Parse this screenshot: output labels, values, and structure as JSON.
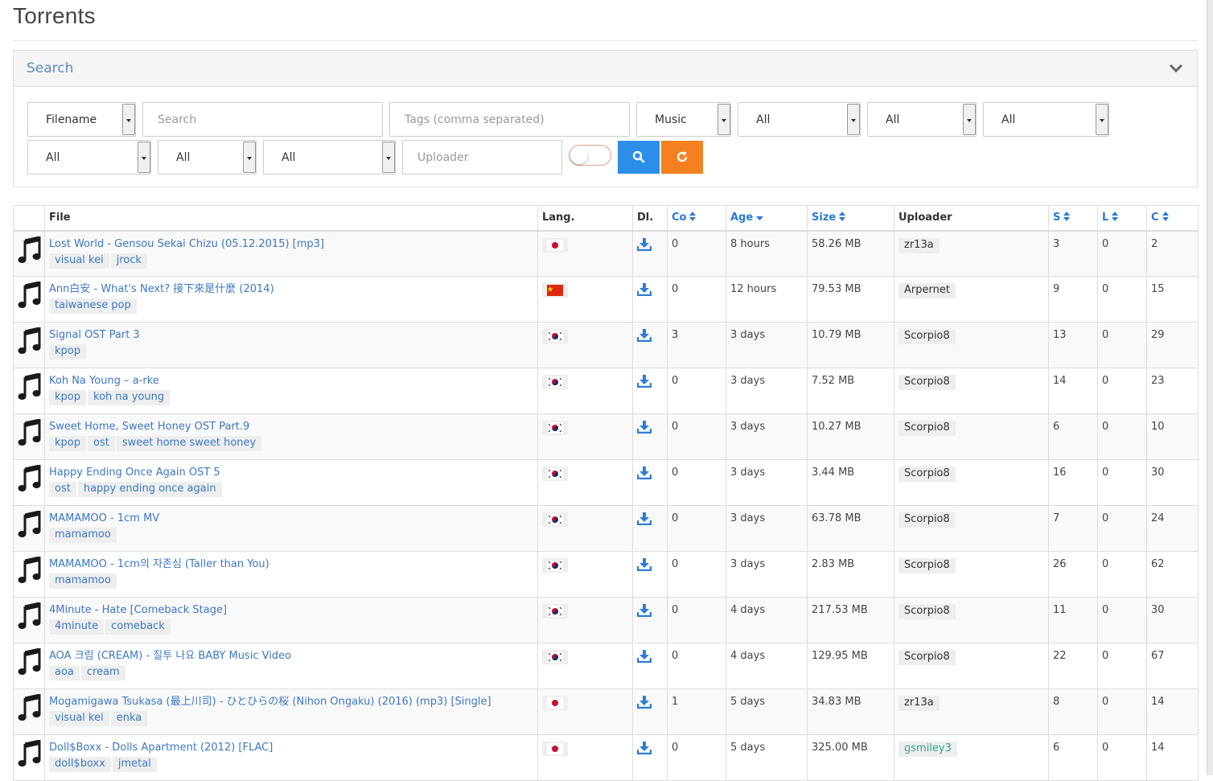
{
  "page": {
    "title": "Torrents"
  },
  "search": {
    "panel_title": "Search",
    "filename_select": "Filename",
    "search_placeholder": "Search",
    "tags_placeholder": "Tags (comma separated)",
    "category_select": "Music",
    "select_2": "All",
    "select_3": "All",
    "select_4": "All",
    "select_5": "All",
    "select_6": "All",
    "select_7": "All",
    "uploader_placeholder": "Uploader"
  },
  "table": {
    "headers": {
      "file": "File",
      "lang": "Lang.",
      "dl": "Dl.",
      "co": "Co",
      "age": "Age",
      "size": "Size",
      "uploader": "Uploader",
      "s": "S",
      "l": "L",
      "c": "C"
    },
    "rows": [
      {
        "name": "Lost World - Gensou Sekai Chizu (05.12.2015) [mp3]",
        "tags": [
          "visual kei",
          "jrock"
        ],
        "lang": "jp",
        "co": "0",
        "age": "8 hours",
        "size": "58.26 MB",
        "uploader": "zr13a",
        "s": "3",
        "l": "0",
        "c": "2"
      },
      {
        "name": "Ann白安 - What's Next? 接下來是什麼 (2014)",
        "tags": [
          "taiwanese pop"
        ],
        "lang": "cn",
        "co": "0",
        "age": "12 hours",
        "size": "79.53 MB",
        "uploader": "Arpernet",
        "s": "9",
        "l": "0",
        "c": "15"
      },
      {
        "name": "Signal OST Part 3",
        "tags": [
          "kpop"
        ],
        "lang": "kr",
        "co": "3",
        "age": "3 days",
        "size": "10.79 MB",
        "uploader": "Scorpio8",
        "s": "13",
        "l": "0",
        "c": "29"
      },
      {
        "name": "Koh Na Young – a-rke",
        "tags": [
          "kpop",
          "koh na young"
        ],
        "lang": "kr",
        "co": "0",
        "age": "3 days",
        "size": "7.52 MB",
        "uploader": "Scorpio8",
        "s": "14",
        "l": "0",
        "c": "23"
      },
      {
        "name": "Sweet Home, Sweet Honey OST Part.9",
        "tags": [
          "kpop",
          "ost",
          "sweet home sweet honey"
        ],
        "lang": "kr",
        "co": "0",
        "age": "3 days",
        "size": "10.27 MB",
        "uploader": "Scorpio8",
        "s": "6",
        "l": "0",
        "c": "10"
      },
      {
        "name": "Happy Ending Once Again OST 5",
        "tags": [
          "ost",
          "happy ending once again"
        ],
        "lang": "kr",
        "co": "0",
        "age": "3 days",
        "size": "3.44 MB",
        "uploader": "Scorpio8",
        "s": "16",
        "l": "0",
        "c": "30"
      },
      {
        "name": "MAMAMOO - 1cm MV",
        "tags": [
          "mamamoo"
        ],
        "lang": "kr",
        "co": "0",
        "age": "3 days",
        "size": "63.78 MB",
        "uploader": "Scorpio8",
        "s": "7",
        "l": "0",
        "c": "24"
      },
      {
        "name": "MAMAMOO - 1cm의 자존심 (Taller than You)",
        "tags": [
          "mamamoo"
        ],
        "lang": "kr",
        "co": "0",
        "age": "3 days",
        "size": "2.83 MB",
        "uploader": "Scorpio8",
        "s": "26",
        "l": "0",
        "c": "62"
      },
      {
        "name": "4Minute - Hate [Comeback Stage]",
        "tags": [
          "4minute",
          "comeback"
        ],
        "lang": "kr",
        "co": "0",
        "age": "4 days",
        "size": "217.53 MB",
        "uploader": "Scorpio8",
        "s": "11",
        "l": "0",
        "c": "30"
      },
      {
        "name": "AOA 크림 (CREAM) - 질투 나요 BABY Music Video",
        "tags": [
          "aoa",
          "cream"
        ],
        "lang": "kr",
        "co": "0",
        "age": "4 days",
        "size": "129.95 MB",
        "uploader": "Scorpio8",
        "s": "22",
        "l": "0",
        "c": "67"
      },
      {
        "name": "Mogamigawa Tsukasa (最上川司) - ひとひらの桜 (Nihon Ongaku) (2016) (mp3) [Single]",
        "tags": [
          "visual kei",
          "enka"
        ],
        "lang": "jp",
        "co": "1",
        "age": "5 days",
        "size": "34.83 MB",
        "uploader": "zr13a",
        "s": "8",
        "l": "0",
        "c": "14"
      },
      {
        "name": "Doll$Boxx - Dolls Apartment (2012) [FLAC]",
        "tags": [
          "doll$boxx",
          "jmetal"
        ],
        "lang": "jp",
        "co": "0",
        "age": "5 days",
        "size": "325.00 MB",
        "uploader": "gsmiley3",
        "uploader_color": "#2eaa8f",
        "s": "6",
        "l": "0",
        "c": "14"
      }
    ]
  },
  "colors": {
    "link": "#3b78c4",
    "search_button": "#2d8ee8",
    "reset_button": "#f5801f",
    "tag_bg": "#eeeeee"
  }
}
